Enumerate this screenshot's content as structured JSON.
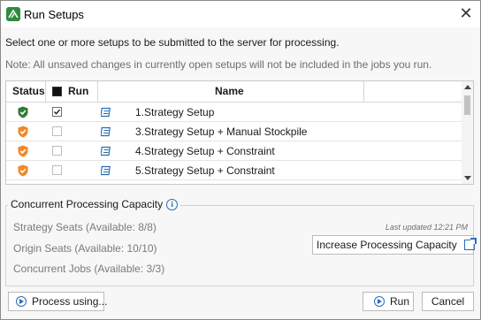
{
  "window": {
    "title": "Run Setups",
    "close_glyph": "✕",
    "app_icon": "app-logo-icon"
  },
  "instructions": {
    "line1": "Select one or more setups to be submitted to the server for processing.",
    "line2": "Note: All unsaved changes in currently open setups will not be included in the jobs you run."
  },
  "grid": {
    "columns": {
      "status": "Status",
      "run": "Run",
      "name": "Name"
    },
    "select_all_checked": true,
    "rows": [
      {
        "status": "ok",
        "status_icon": "shield-check-icon",
        "status_color": "#2e7d32",
        "checked": true,
        "name": "1.Strategy Setup"
      },
      {
        "status": "warning",
        "status_icon": "shield-warning-icon",
        "status_color": "#f0892a",
        "checked": false,
        "name": "3.Strategy Setup + Manual Stockpile"
      },
      {
        "status": "warning",
        "status_icon": "shield-warning-icon",
        "status_color": "#f0892a",
        "checked": false,
        "name": "4.Strategy Setup + Constraint"
      },
      {
        "status": "warning",
        "status_icon": "shield-warning-icon",
        "status_color": "#f0892a",
        "checked": false,
        "name": "5.Strategy Setup + Constraint"
      }
    ]
  },
  "capacity": {
    "title": "Concurrent Processing Capacity",
    "strategy_seats": "Strategy Seats (Available: 8/8)",
    "origin_seats": "Origin Seats (Available: 10/10)",
    "concurrent_jobs": "Concurrent Jobs (Available: 3/3)",
    "last_updated": "Last updated 12:21 PM",
    "increase_button": "Increase Processing Capacity"
  },
  "footer": {
    "process_using": "Process using...",
    "run": "Run",
    "cancel": "Cancel"
  },
  "colors": {
    "accent": "#2a6db5",
    "ok": "#2e7d32",
    "warning": "#f0892a"
  }
}
